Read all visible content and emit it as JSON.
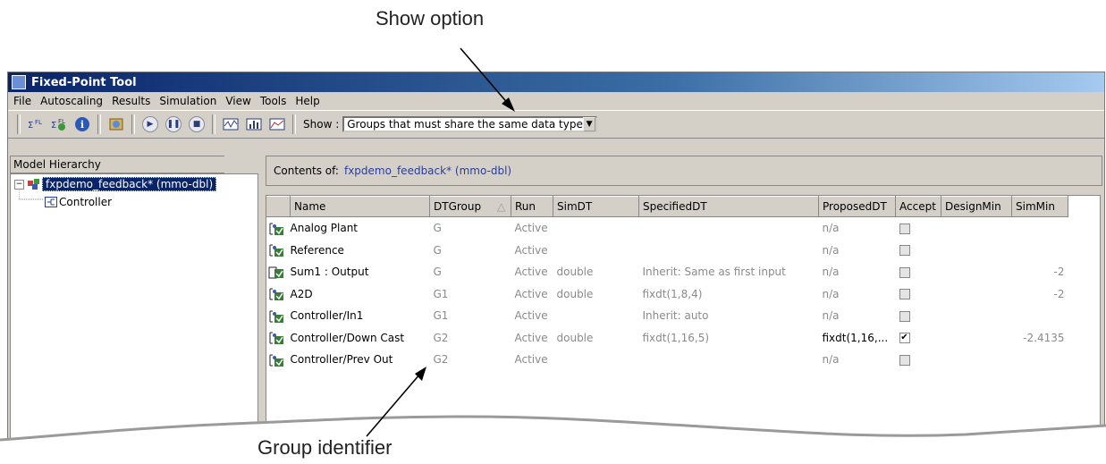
{
  "annotations": {
    "top": "Show option",
    "bottom": "Group identifier"
  },
  "window": {
    "title": "Fixed-Point Tool"
  },
  "menu": [
    "File",
    "Autoscaling",
    "Results",
    "Simulation",
    "View",
    "Tools",
    "Help"
  ],
  "toolbar": {
    "show_label": "Show :",
    "show_value": "Groups that must share the same data type"
  },
  "tree": {
    "header": "Model Hierarchy",
    "root": "fxpdemo_feedback* (mmo-dbl)",
    "child": "Controller"
  },
  "contents": {
    "label": "Contents of:",
    "system": "fxpdemo_feedback* (mmo-dbl)"
  },
  "columns": [
    "Name",
    "DTGroup",
    "Run",
    "SimDT",
    "SpecifiedDT",
    "ProposedDT",
    "Accept",
    "DesignMin",
    "SimMin"
  ],
  "sort_indicator": "△",
  "rows": [
    {
      "name": "Analog Plant",
      "dtgroup": "G",
      "run": "Active",
      "simdt": "",
      "specdt": "",
      "propdt": "n/a",
      "accept": false,
      "designmin": "",
      "simmin": ""
    },
    {
      "name": "Reference",
      "dtgroup": "G",
      "run": "Active",
      "simdt": "",
      "specdt": "",
      "propdt": "n/a",
      "accept": false,
      "designmin": "",
      "simmin": ""
    },
    {
      "name": "Sum1 : Output",
      "dtgroup": "G",
      "run": "Active",
      "simdt": "double",
      "specdt": "Inherit: Same as first input",
      "propdt": "n/a",
      "accept": false,
      "designmin": "",
      "simmin": "-2"
    },
    {
      "name": "A2D",
      "dtgroup": "G1",
      "run": "Active",
      "simdt": "double",
      "specdt": "fixdt(1,8,4)",
      "propdt": "n/a",
      "accept": false,
      "designmin": "",
      "simmin": "-2"
    },
    {
      "name": "Controller/In1",
      "dtgroup": "G1",
      "run": "Active",
      "simdt": "",
      "specdt": "Inherit: auto",
      "propdt": "n/a",
      "accept": false,
      "designmin": "",
      "simmin": ""
    },
    {
      "name": "Controller/Down Cast",
      "dtgroup": "G2",
      "run": "Active",
      "simdt": "double",
      "specdt": "fixdt(1,16,5)",
      "propdt": "fixdt(1,16,...",
      "accept": true,
      "designmin": "",
      "simmin": "-2.4135"
    },
    {
      "name": "Controller/Prev Out",
      "dtgroup": "G2",
      "run": "Active",
      "simdt": "",
      "specdt": "",
      "propdt": "n/a",
      "accept": false,
      "designmin": "",
      "simmin": ""
    }
  ]
}
